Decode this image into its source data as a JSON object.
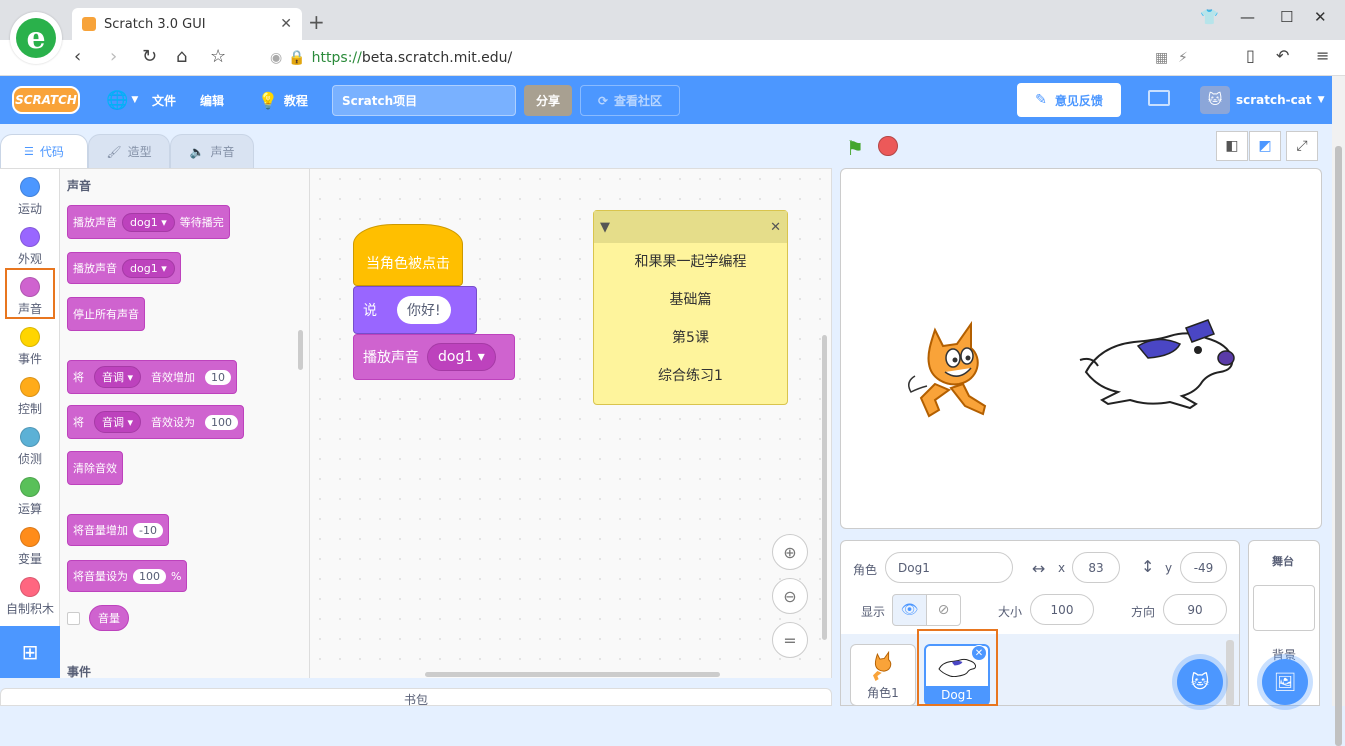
{
  "browser": {
    "tab_title": "Scratch 3.0 GUI",
    "url_scheme": "https://",
    "url_host": "beta.scratch.mit.edu/",
    "url_sub": "beta.scratch.",
    "url_domain": "mit.edu"
  },
  "menubar": {
    "logo": "SCRATCH",
    "file": "文件",
    "edit": "编辑",
    "tutorials": "教程",
    "project_title": "Scratch项目",
    "share": "分享",
    "community": "查看社区",
    "feedback": "意见反馈",
    "username": "scratch-cat"
  },
  "editor_tabs": {
    "code": "代码",
    "costumes": "造型",
    "sounds": "声音"
  },
  "categories": [
    {
      "label": "运动",
      "color": "#4c97ff"
    },
    {
      "label": "外观",
      "color": "#9966ff"
    },
    {
      "label": "声音",
      "color": "#cf63cf"
    },
    {
      "label": "事件",
      "color": "#ffd500"
    },
    {
      "label": "控制",
      "color": "#ffab19"
    },
    {
      "label": "侦测",
      "color": "#5cb1d6"
    },
    {
      "label": "运算",
      "color": "#59c059"
    },
    {
      "label": "变量",
      "color": "#ff8c1a"
    },
    {
      "label": "自制积木",
      "color": "#ff6680"
    }
  ],
  "palette": {
    "heading_sound": "声音",
    "play_until_done": "播放声音",
    "play_until_done_sound": "dog1",
    "play_until_done_suffix": "等待播完",
    "start_sound": "播放声音",
    "start_sound_sound": "dog1",
    "stop_all": "停止所有声音",
    "change_effect_prefix": "将",
    "change_effect_effect": "音调",
    "change_effect_mid": "音效增加",
    "change_effect_value": "10",
    "set_effect_prefix": "将",
    "set_effect_effect": "音调",
    "set_effect_mid": "音效设为",
    "set_effect_value": "100",
    "clear_effects": "清除音效",
    "change_volume": "将音量增加",
    "change_volume_value": "-10",
    "set_volume": "将音量设为",
    "set_volume_value": "100",
    "set_volume_unit": "%",
    "volume_reporter": "音量",
    "heading_events": "事件"
  },
  "script": {
    "hat": "当角色被点击",
    "say": "说",
    "say_value": "你好!",
    "play": "播放声音",
    "play_sound": "dog1"
  },
  "note": {
    "lines": [
      "和果果一起学编程",
      "基础篇",
      "第5课",
      "综合练习1"
    ]
  },
  "backpack": "书包",
  "sprite_info": {
    "sprite_label": "角色",
    "sprite_name": "Dog1",
    "x_label": "x",
    "x": "83",
    "y_label": "y",
    "y": "-49",
    "show_label": "显示",
    "size_label": "大小",
    "size": "100",
    "direction_label": "方向",
    "direction": "90"
  },
  "sprites": [
    {
      "name": "角色1"
    },
    {
      "name": "Dog1"
    }
  ],
  "stage_pane": {
    "title": "舞台",
    "backdrop_label": "背景"
  }
}
